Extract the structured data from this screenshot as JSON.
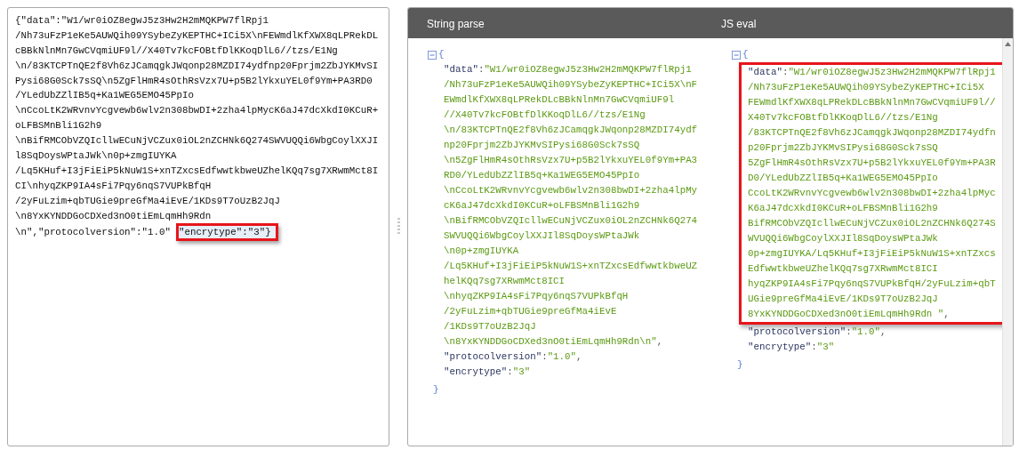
{
  "raw_panel": {
    "lines": [
      "{\"data\":\"W1/wr0iOZ8egwJ5z3Hw2H2mMQKPW7flRpj1",
      "/Nh73uFzP1eKe5AUWQih09YSybeZyKEPTHC+ICi5X\\nFEWmdlKfXWX8qLPRekDL",
      "cBBkNlnMn7GwCVqmiUF9l//X40Tv7kcFOBtfDlKKoqDlL6//tzs/E1Ng",
      "\\n/83KTCPTnQE2f8Vh6zJCamqgkJWqonp28MZDI74ydfnp20Fprjm2ZbJYKMvSI",
      "Pysi68G0Sck7sSQ\\n5ZgFlHmR4sOthRsVzx7U+p5B2lYkxuYEL0f9Ym+PA3RD0",
      "/YLedUbZZlIB5q+Ka1WEG5EMO45PpIo",
      "\\nCcoLtK2WRvnvYcgvewb6wlv2n308bwDI+2zha4lpMycK6aJ47dcXkdI0KCuR+",
      "oLFBSMnBli1G2h9",
      "\\nBifRMCObVZQIcllwECuNjVCZux0iOL2nZCHNk6Q274SWVUQQi6WbgCoylXXJI",
      "l8SqDoysWPtaJWk\\n0p+zmgIUYKA",
      "/Lq5KHuf+I3jFiEiP5kNuW1S+xnTZxcsEdfwwtkbweUZhelKQq7sg7XRwmMct8I",
      "CI\\nhyqZKP9IA4sFi7Pqy6nqS7VUPkBfqH",
      "/2yFuLzim+qbTUGie9preGfMa4iEvE/1KDs9T7oUzB2JqJ",
      "\\n8YxKYNDDGoCDXed3nO0tiEmLqmHh9Rdn",
      "\\n\",\"protocolversion\":\"1.0\""
    ],
    "marked_text": "\"encrytype\":\"3\"}"
  },
  "results": {
    "columns": [
      {
        "title": "String parse",
        "expanded": true,
        "open_brace": "{",
        "close_brace": "}",
        "entries": [
          {
            "highlighted": false,
            "lines": [
              [
                {
                  "kind": "key",
                  "text": "\"data\""
                },
                {
                  "kind": "punct",
                  "text": ":"
                },
                {
                  "kind": "string",
                  "text": "\"W1/wr0iOZ8egwJ5z3Hw2H2mMQKPW7flRpj1"
                }
              ],
              [
                {
                  "kind": "string",
                  "text": "/Nh73uFzP1eKe5AUWQih09YSybeZyKEPTHC+ICi5X\\nF"
                }
              ],
              [
                {
                  "kind": "string",
                  "text": "EWmdlKfXWX8qLPRekDLcBBkNlnMn7GwCVqmiUF9l"
                }
              ],
              [
                {
                  "kind": "string",
                  "text": "//X40Tv7kcFOBtfDlKKoqDlL6//tzs/E1Ng"
                }
              ],
              [
                {
                  "kind": "string",
                  "text": "\\n/83KTCPTnQE2f8Vh6zJCamqgkJWqonp28MZDI74ydf"
                }
              ],
              [
                {
                  "kind": "string",
                  "text": "np20Fprjm2ZbJYKMvSIPysi68G0Sck7sSQ"
                }
              ],
              [
                {
                  "kind": "string",
                  "text": "\\n5ZgFlHmR4sOthRsVzx7U+p5B2lYkxuYEL0f9Ym+PA3"
                }
              ],
              [
                {
                  "kind": "string",
                  "text": "RD0/YLedUbZZlIB5q+Ka1WEG5EMO45PpIo"
                }
              ],
              [
                {
                  "kind": "string",
                  "text": "\\nCcoLtK2WRvnvYcgvewb6wlv2n308bwDI+2zha4lpMy"
                }
              ],
              [
                {
                  "kind": "string",
                  "text": "cK6aJ47dcXkdI0KCuR+oLFBSMnBli1G2h9"
                }
              ],
              [
                {
                  "kind": "string",
                  "text": "\\nBifRMCObVZQIcllwECuNjVCZux0iOL2nZCHNk6Q274"
                }
              ],
              [
                {
                  "kind": "string",
                  "text": "SWVUQQi6WbgCoylXXJIl8SqDoysWPtaJWk"
                }
              ],
              [
                {
                  "kind": "string",
                  "text": "\\n0p+zmgIUYKA"
                }
              ],
              [
                {
                  "kind": "string",
                  "text": "/Lq5KHuf+I3jFiEiP5kNuW1S+xnTZxcsEdfwwtkbweUZ"
                }
              ],
              [
                {
                  "kind": "string",
                  "text": "helKQq7sg7XRwmMct8ICI"
                }
              ],
              [
                {
                  "kind": "string",
                  "text": "\\nhyqZKP9IA4sFi7Pqy6nqS7VUPkBfqH"
                }
              ],
              [
                {
                  "kind": "string",
                  "text": "/2yFuLzim+qbTUGie9preGfMa4iEvE"
                }
              ],
              [
                {
                  "kind": "string",
                  "text": "/1KDs9T7oUzB2JqJ"
                }
              ],
              [
                {
                  "kind": "string",
                  "text": "\\n8YxKYNDDGoCDXed3nO0tiEmLqmHh9Rdn\\n\""
                },
                {
                  "kind": "punct",
                  "text": ","
                }
              ]
            ]
          },
          {
            "highlighted": false,
            "lines": [
              [
                {
                  "kind": "key",
                  "text": "\"protocolversion\""
                },
                {
                  "kind": "punct",
                  "text": ":"
                },
                {
                  "kind": "string",
                  "text": "\"1.0\""
                },
                {
                  "kind": "punct",
                  "text": ","
                }
              ]
            ]
          },
          {
            "highlighted": false,
            "lines": [
              [
                {
                  "kind": "key",
                  "text": "\"encrytype\""
                },
                {
                  "kind": "punct",
                  "text": ":"
                },
                {
                  "kind": "string",
                  "text": "\"3\""
                }
              ]
            ]
          }
        ]
      },
      {
        "title": "JS eval",
        "expanded": true,
        "open_brace": "{",
        "close_brace": "}",
        "entries": [
          {
            "highlighted": true,
            "lines": [
              [
                {
                  "kind": "key",
                  "text": "\"data\""
                },
                {
                  "kind": "punct",
                  "text": ":"
                },
                {
                  "kind": "string",
                  "text": "\"W1/wr0iOZ8egwJ5z3Hw2H2mMQKPW7flRpj1"
                }
              ],
              [
                {
                  "kind": "string",
                  "text": "/Nh73uFzP1eKe5AUWQih09YSybeZyKEPTHC+ICi5X"
                }
              ],
              [
                {
                  "kind": "string",
                  "text": "FEWmdlKfXWX8qLPRekDLcBBkNlnMn7GwCVqmiUF9l//"
                }
              ],
              [
                {
                  "kind": "string",
                  "text": "X40Tv7kcFOBtfDlKKoqDlL6//tzs/E1Ng"
                }
              ],
              [
                {
                  "kind": "string",
                  "text": "/83KTCPTnQE2f8Vh6zJCamqgkJWqonp28MZDI74ydfn"
                }
              ],
              [
                {
                  "kind": "string",
                  "text": "p20Fprjm2ZbJYKMvSIPysi68G0Sck7sSQ"
                }
              ],
              [
                {
                  "kind": "string",
                  "text": "5ZgFlHmR4sOthRsVzx7U+p5B2lYkxuYEL0f9Ym+PA3R"
                }
              ],
              [
                {
                  "kind": "string",
                  "text": "D0/YLedUbZZlIB5q+Ka1WEG5EMO45PpIo"
                }
              ],
              [
                {
                  "kind": "string",
                  "text": "CcoLtK2WRvnvYcgvewb6wlv2n308bwDI+2zha4lpMyc"
                }
              ],
              [
                {
                  "kind": "string",
                  "text": "K6aJ47dcXkdI0KCuR+oLFBSMnBli1G2h9"
                }
              ],
              [
                {
                  "kind": "string",
                  "text": "BifRMCObVZQIcllwECuNjVCZux0iOL2nZCHNk6Q274S"
                }
              ],
              [
                {
                  "kind": "string",
                  "text": "WVUQQi6WbgCoylXXJIl8SqDoysWPtaJWk"
                }
              ],
              [
                {
                  "kind": "string",
                  "text": "0p+zmgIUYKA/Lq5KHuf+I3jFiEiP5kNuW1S+xnTZxcs"
                }
              ],
              [
                {
                  "kind": "string",
                  "text": "EdfwwtkbweUZhelKQq7sg7XRwmMct8ICI"
                }
              ],
              [
                {
                  "kind": "string",
                  "text": "hyqZKP9IA4sFi7Pqy6nqS7VUPkBfqH/2yFuLzim+qbT"
                }
              ],
              [
                {
                  "kind": "string",
                  "text": "UGie9preGfMa4iEvE/1KDs9T7oUzB2JqJ"
                }
              ],
              [
                {
                  "kind": "string",
                  "text": "8YxKYNDDGoCDXed3nO0tiEmLqmHh9Rdn \""
                },
                {
                  "kind": "punct",
                  "text": ","
                }
              ]
            ]
          },
          {
            "highlighted": false,
            "lines": [
              [
                {
                  "kind": "key",
                  "text": "\"protocolversion\""
                },
                {
                  "kind": "punct",
                  "text": ":"
                },
                {
                  "kind": "string",
                  "text": "\"1.0\""
                },
                {
                  "kind": "punct",
                  "text": ","
                }
              ]
            ]
          },
          {
            "highlighted": false,
            "lines": [
              [
                {
                  "kind": "key",
                  "text": "\"encrytype\""
                },
                {
                  "kind": "punct",
                  "text": ":"
                },
                {
                  "kind": "string",
                  "text": "\"3\""
                }
              ]
            ]
          }
        ]
      }
    ]
  }
}
